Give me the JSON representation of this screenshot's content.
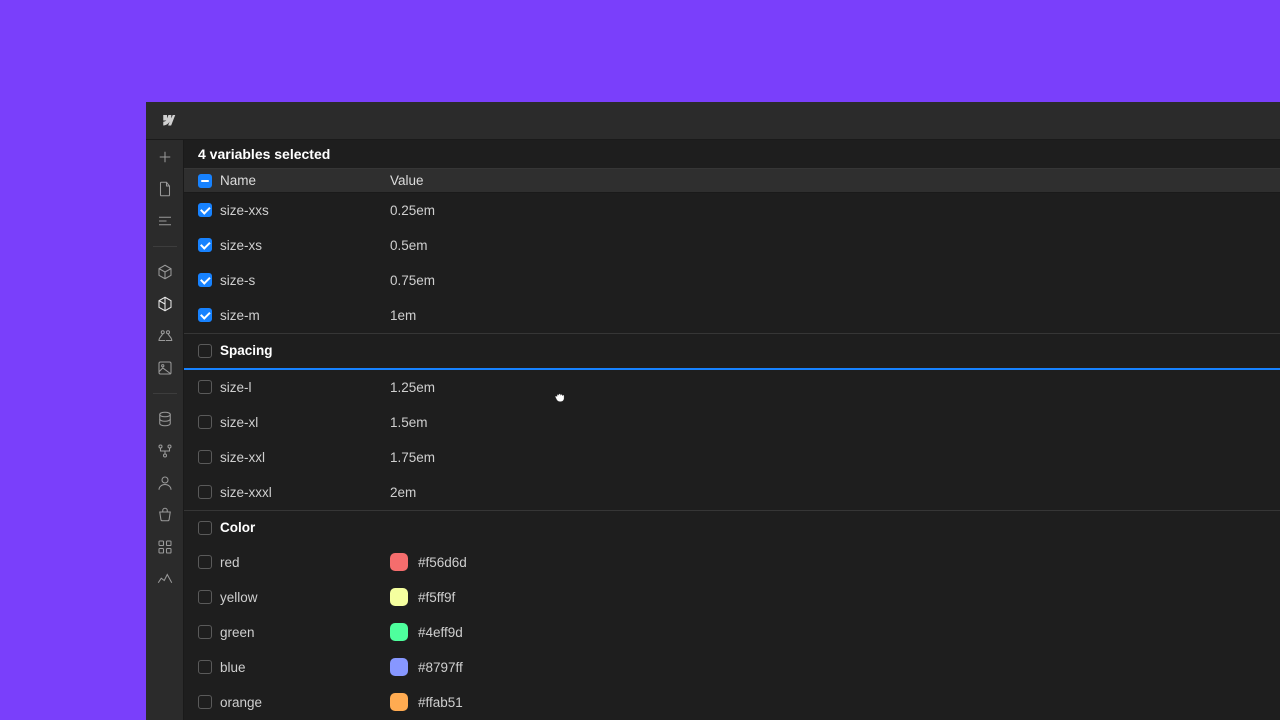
{
  "header": {
    "title": "4 variables selected"
  },
  "columns": {
    "name": "Name",
    "value": "Value"
  },
  "groups": {
    "spacing_label": "Spacing",
    "color_label": "Color"
  },
  "size_rows": [
    {
      "name": "size-xxs",
      "value": "0.25em",
      "checked": true
    },
    {
      "name": "size-xs",
      "value": "0.5em",
      "checked": true
    },
    {
      "name": "size-s",
      "value": "0.75em",
      "checked": true
    },
    {
      "name": "size-m",
      "value": "1em",
      "checked": true
    }
  ],
  "size_rows_2": [
    {
      "name": "size-l",
      "value": "1.25em",
      "checked": false
    },
    {
      "name": "size-xl",
      "value": "1.5em",
      "checked": false
    },
    {
      "name": "size-xxl",
      "value": "1.75em",
      "checked": false
    },
    {
      "name": "size-xxxl",
      "value": "2em",
      "checked": false
    }
  ],
  "color_rows": [
    {
      "name": "red",
      "value": "#f56d6d",
      "swatch": "#f56d6d"
    },
    {
      "name": "yellow",
      "value": "#f5ff9f",
      "swatch": "#f5ff9f"
    },
    {
      "name": "green",
      "value": "#4eff9d",
      "swatch": "#4eff9d"
    },
    {
      "name": "blue",
      "value": "#8797ff",
      "swatch": "#8797ff"
    },
    {
      "name": "orange",
      "value": "#ffab51",
      "swatch": "#ffab51"
    }
  ]
}
